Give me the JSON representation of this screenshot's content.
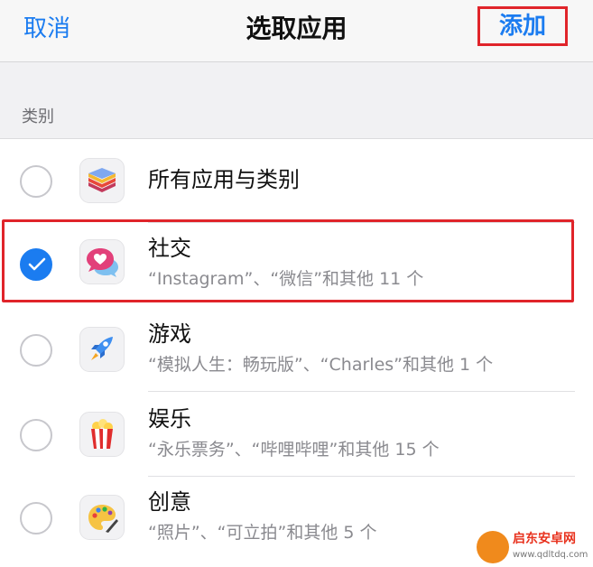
{
  "navbar": {
    "cancel_label": "取消",
    "title": "选取应用",
    "add_label": "添加"
  },
  "section": {
    "label": "类别"
  },
  "rows": [
    {
      "title": "所有应用与类别",
      "subtitle": "",
      "checked": false,
      "icon": "stack-layers-icon"
    },
    {
      "title": "社交",
      "subtitle": "“Instagram”、“微信”和其他 11 个",
      "checked": true,
      "icon": "chat-heart-icon"
    },
    {
      "title": "游戏",
      "subtitle": "“模拟人生：畅玩版”、“Charles”和其他 1 个",
      "checked": false,
      "icon": "rocket-icon"
    },
    {
      "title": "娱乐",
      "subtitle": "“永乐票务”、“哔哩哔哩”和其他 15 个",
      "checked": false,
      "icon": "popcorn-icon"
    },
    {
      "title": "创意",
      "subtitle": "“照片”、“可立拍”和其他 5 个",
      "checked": false,
      "icon": "palette-icon"
    }
  ],
  "watermark": {
    "name": "启东安卓网",
    "url": "www.qdltdq.com"
  },
  "colors": {
    "accent": "#1b7cf0",
    "highlight": "#e0242a"
  }
}
